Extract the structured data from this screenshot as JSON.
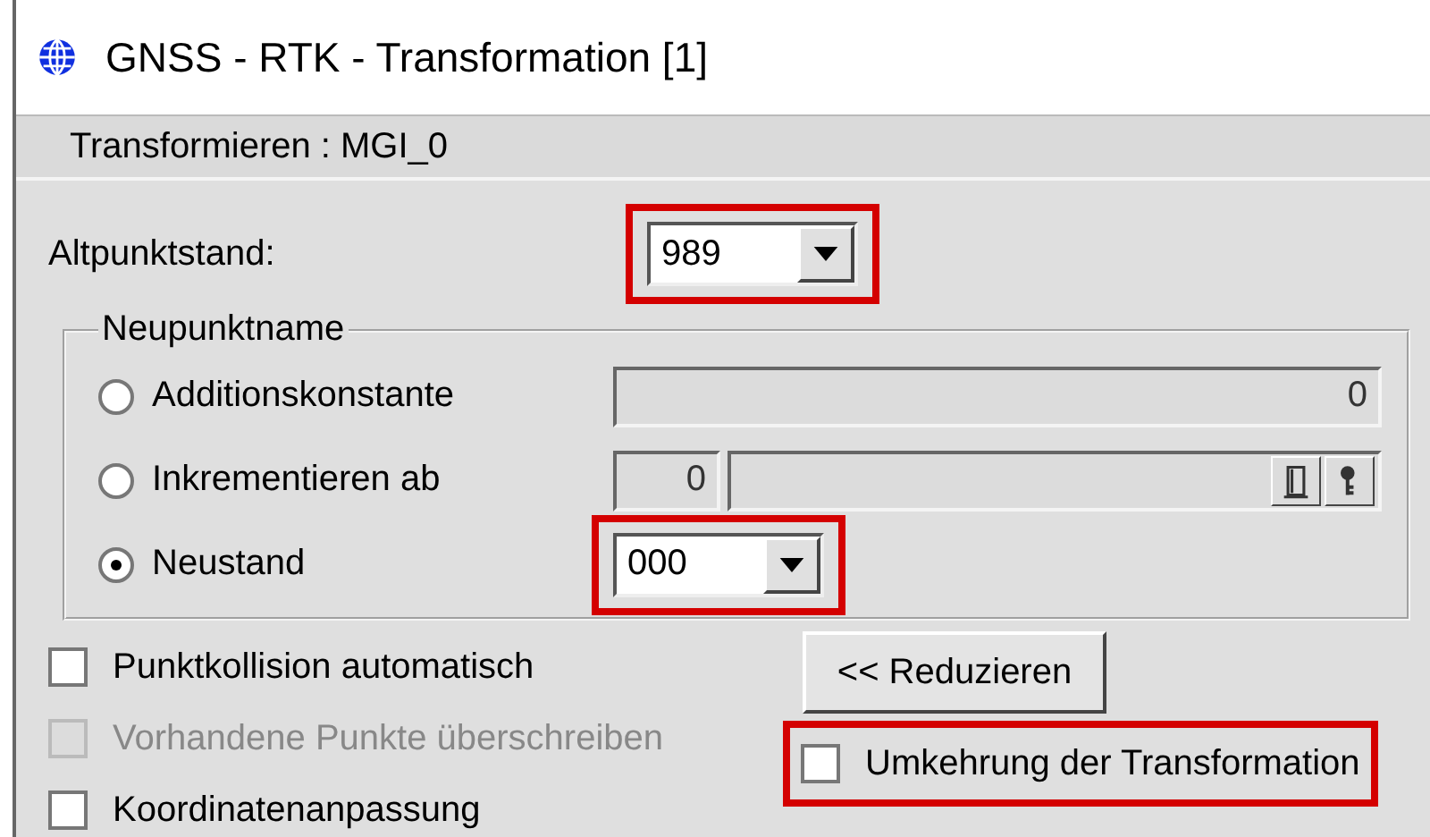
{
  "window": {
    "title": "GNSS - RTK - Transformation [1]"
  },
  "subtitle": "Transformieren : MGI_0",
  "altpunktstand": {
    "label": "Altpunktstand:",
    "value": "989",
    "highlighted": true
  },
  "neupunktname": {
    "legend": "Neupunktname",
    "options": [
      {
        "kind": "field",
        "label": "Additionskonstante",
        "selected": false,
        "value": "0",
        "disabled": true
      },
      {
        "kind": "increment",
        "label": "Inkrementieren ab",
        "selected": false,
        "value": "0",
        "disabled": true
      },
      {
        "kind": "combo",
        "label": "Neustand",
        "selected": true,
        "value": "000",
        "highlighted": true
      }
    ]
  },
  "checkboxes": [
    {
      "label": "Punktkollision automatisch",
      "checked": false,
      "disabled": false
    },
    {
      "label": "Vorhandene Punkte überschreiben",
      "checked": false,
      "disabled": true
    },
    {
      "label": "Koordinatenanpassung",
      "checked": false,
      "disabled": false
    }
  ],
  "reduce_button": "<< Reduzieren",
  "reverse": {
    "label": "Umkehrung der Transformation",
    "checked": false,
    "highlighted": true
  }
}
